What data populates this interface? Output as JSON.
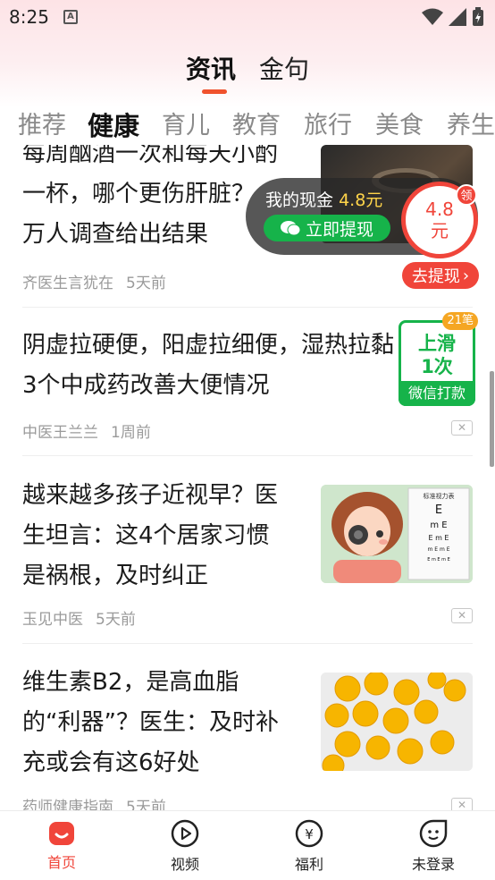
{
  "status_bar": {
    "time": "8:25"
  },
  "main_tabs": [
    {
      "label": "资讯"
    },
    {
      "label": "金句"
    }
  ],
  "category_tabs": [
    {
      "label": "推荐"
    },
    {
      "label": "健康"
    },
    {
      "label": "育儿"
    },
    {
      "label": "教育"
    },
    {
      "label": "旅行"
    },
    {
      "label": "美食"
    },
    {
      "label": "养生"
    }
  ],
  "articles": [
    {
      "title_lines": [
        "每周酗酒一次和每天小酌",
        "一杯，哪个更伤肝脏？",
        "万人调查给出结果"
      ],
      "source": "齐医生言犹在",
      "time": "5天前"
    },
    {
      "title_lines": [
        "阴虚拉硬便，阳虚拉细便，湿热拉黏",
        "3个中成药改善大便情况"
      ],
      "source": "中医王兰兰",
      "time": "1周前"
    },
    {
      "title_lines": [
        "越来越多孩子近视早？医",
        "生坦言：这4个居家习惯",
        "是祸根，及时纠正"
      ],
      "source": "玉见中医",
      "time": "5天前"
    },
    {
      "title_lines": [
        "维生素B2，是高血脂",
        "的“利器”？医生：及时补",
        "充或会有这6好处"
      ],
      "source": "药师健康指南",
      "time": "5天前"
    }
  ],
  "eye_chart_title": "标准视力表",
  "cash_widget": {
    "label": "我的现金",
    "amount": "4.8元",
    "withdraw_label": "立即提现",
    "coin_value": "4.8",
    "coin_unit": "元",
    "collect_badge": "领",
    "go_withdraw": "去提现"
  },
  "slide_widget": {
    "line1": "上滑",
    "line2": "1次",
    "footer": "微信打款",
    "badge": "21笔"
  },
  "bottom_nav": [
    {
      "label": "首页",
      "icon": "home-icon"
    },
    {
      "label": "视频",
      "icon": "video-play-icon"
    },
    {
      "label": "福利",
      "icon": "yen-coin-icon"
    },
    {
      "label": "未登录",
      "icon": "avatar-face-icon"
    }
  ],
  "colors": {
    "accent_red": "#f0453a",
    "wechat_green": "#16b34a",
    "tab_indicator": "#f0522d"
  }
}
